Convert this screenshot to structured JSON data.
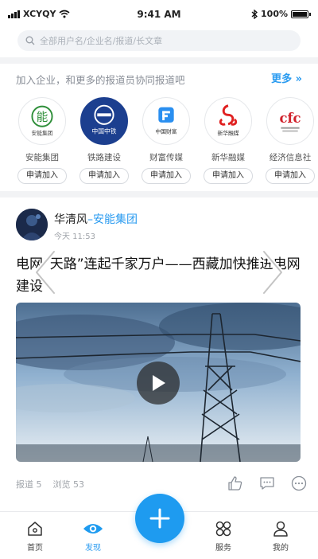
{
  "status_bar": {
    "carrier": "XCYQY",
    "time": "9:41 AM",
    "battery": "100%"
  },
  "search": {
    "placeholder": "全部用户名/企业名/报道/长文章"
  },
  "join_section": {
    "prompt": "加入企业，和更多的报道员协同报道吧",
    "more_label": "更多 »",
    "orgs": [
      {
        "name": "安能集团",
        "button": "申请加入",
        "logo_text": "能",
        "logo_sub": "安能集团"
      },
      {
        "name": "铁路建设",
        "button": "申请加入",
        "logo_text": "中国中铁"
      },
      {
        "name": "财富传媒",
        "button": "申请加入",
        "logo_text": "中国财富"
      },
      {
        "name": "新华融媒",
        "button": "申请加入",
        "logo_text": "新华融媒"
      },
      {
        "name": "经济信息社",
        "button": "申请加入",
        "logo_text": "cfc"
      }
    ]
  },
  "post": {
    "author": "华清风",
    "separator": "–",
    "org": "安能集团",
    "time": "今天 11:53",
    "title": "电网“天路”连起千家万户——西藏加快推进电网建设",
    "stats": {
      "reports": "报道 5",
      "views": "浏览 53"
    }
  },
  "tabbar": {
    "tabs": [
      {
        "label": "首页"
      },
      {
        "label": "发现"
      },
      {
        "label": "服务"
      },
      {
        "label": "我的"
      }
    ]
  },
  "colors": {
    "accent": "#1e9bf0",
    "muted": "#a0a4aa"
  }
}
